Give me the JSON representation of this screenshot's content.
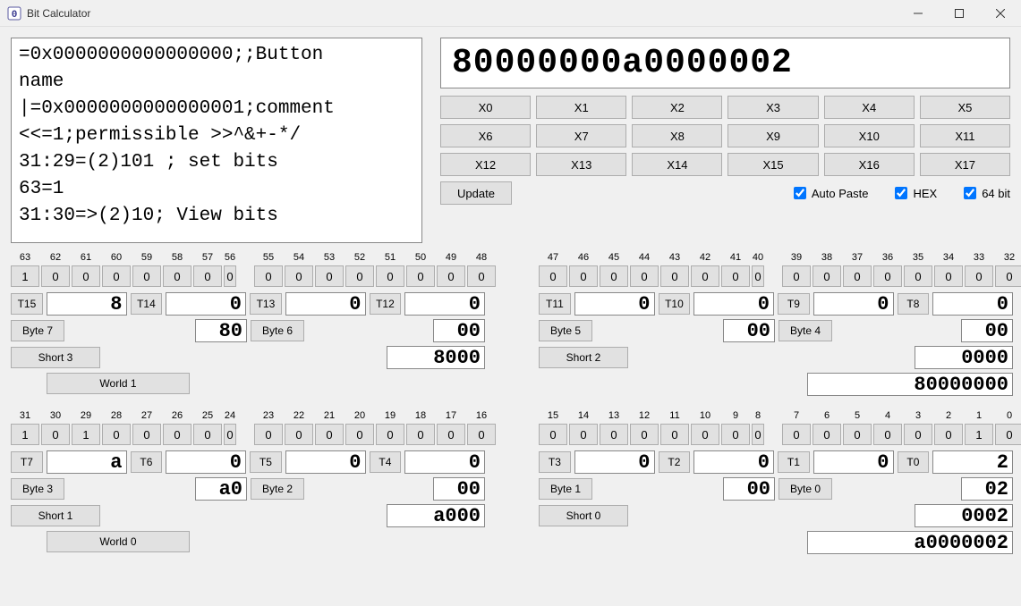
{
  "window": {
    "title": "Bit Calculator"
  },
  "script_text": "=0x0000000000000000;;Button\nname\n|=0x0000000000000001;comment\n<<=1;permissible >>^&+-*/\n31:29=(2)101 ; set bits\n63=1\n31:30=>(2)10; View bits",
  "main_value": "80000000a0000002",
  "x_buttons": [
    "X0",
    "X1",
    "X2",
    "X3",
    "X4",
    "X5",
    "X6",
    "X7",
    "X8",
    "X9",
    "X10",
    "X11",
    "X12",
    "X13",
    "X14",
    "X15",
    "X16",
    "X17"
  ],
  "update_label": "Update",
  "checks": {
    "auto_paste": "Auto Paste",
    "hex": "HEX",
    "bit64": "64 bit"
  },
  "halves": [
    {
      "bit_start": 63,
      "bits": [
        "1",
        "0",
        "0",
        "0",
        "0",
        "0",
        "0",
        "0",
        "0",
        "0",
        "0",
        "0",
        "0",
        "0",
        "0",
        "0"
      ],
      "t_left": [
        {
          "label": "T15",
          "val": "8"
        },
        {
          "label": "T14",
          "val": "0"
        },
        {
          "label": "T13",
          "val": "0"
        },
        {
          "label": "T12",
          "val": "0"
        }
      ],
      "bytes": [
        {
          "label": "Byte 7",
          "val": "80"
        },
        {
          "label": "Byte 6",
          "val": "00"
        }
      ],
      "short": {
        "label": "Short 3",
        "val": "8000"
      },
      "world": {
        "label": "World 1",
        "show": true
      }
    },
    {
      "bit_start": 47,
      "bits": [
        "0",
        "0",
        "0",
        "0",
        "0",
        "0",
        "0",
        "0",
        "0",
        "0",
        "0",
        "0",
        "0",
        "0",
        "0",
        "0"
      ],
      "t_left": [
        {
          "label": "T11",
          "val": "0"
        },
        {
          "label": "T10",
          "val": "0"
        },
        {
          "label": "T9",
          "val": "0"
        },
        {
          "label": "T8",
          "val": "0"
        }
      ],
      "bytes": [
        {
          "label": "Byte 5",
          "val": "00"
        },
        {
          "label": "Byte 4",
          "val": "00"
        }
      ],
      "short": {
        "label": "Short 2",
        "val": "0000"
      },
      "world": {
        "label": "",
        "val": "80000000",
        "show": false
      }
    },
    {
      "bit_start": 31,
      "bits": [
        "1",
        "0",
        "1",
        "0",
        "0",
        "0",
        "0",
        "0",
        "0",
        "0",
        "0",
        "0",
        "0",
        "0",
        "0",
        "0"
      ],
      "t_left": [
        {
          "label": "T7",
          "val": "a"
        },
        {
          "label": "T6",
          "val": "0"
        },
        {
          "label": "T5",
          "val": "0"
        },
        {
          "label": "T4",
          "val": "0"
        }
      ],
      "bytes": [
        {
          "label": "Byte 3",
          "val": "a0"
        },
        {
          "label": "Byte 2",
          "val": "00"
        }
      ],
      "short": {
        "label": "Short 1",
        "val": "a000"
      },
      "world": {
        "label": "World 0",
        "show": true
      }
    },
    {
      "bit_start": 15,
      "bits": [
        "0",
        "0",
        "0",
        "0",
        "0",
        "0",
        "0",
        "0",
        "0",
        "0",
        "0",
        "0",
        "0",
        "0",
        "1",
        "0"
      ],
      "t_left": [
        {
          "label": "T3",
          "val": "0"
        },
        {
          "label": "T2",
          "val": "0"
        },
        {
          "label": "T1",
          "val": "0"
        },
        {
          "label": "T0",
          "val": "2"
        }
      ],
      "bytes": [
        {
          "label": "Byte 1",
          "val": "00"
        },
        {
          "label": "Byte 0",
          "val": "02"
        }
      ],
      "short": {
        "label": "Short 0",
        "val": "0002"
      },
      "world": {
        "label": "",
        "val": "a0000002",
        "show": false
      }
    }
  ]
}
